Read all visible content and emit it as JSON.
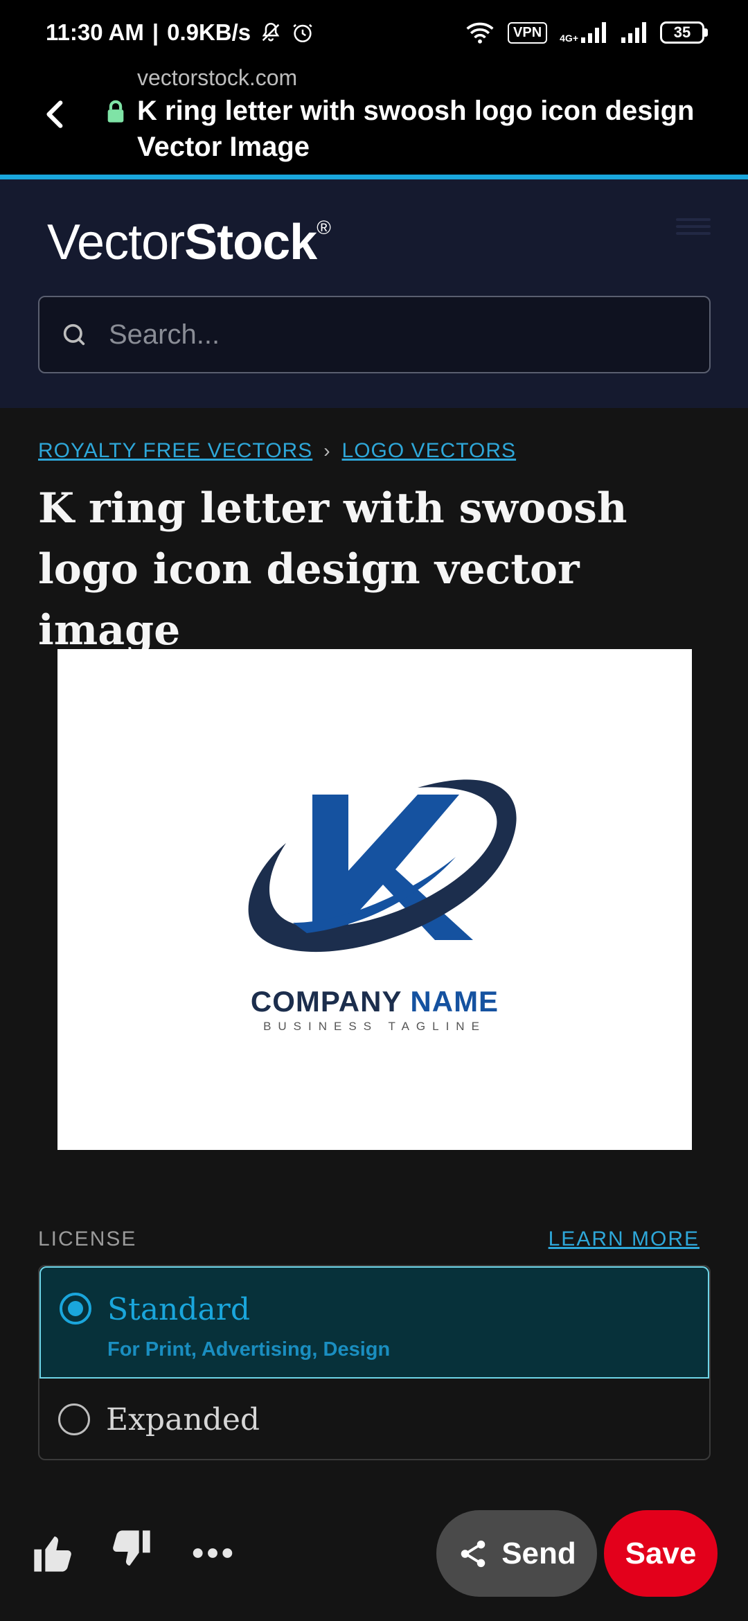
{
  "status_bar": {
    "time": "11:30 AM",
    "speed": "0.9KB/s",
    "vpn": "VPN",
    "network": "4G+",
    "battery": "35"
  },
  "browser": {
    "domain": "vectorstock.com",
    "title": "K ring letter with swoosh logo icon design Vector Image"
  },
  "site": {
    "logo_light": "Vector",
    "logo_bold": "Stock",
    "logo_mark": "®",
    "search_placeholder": "Search..."
  },
  "breadcrumb": {
    "items": [
      "ROYALTY FREE VECTORS",
      "LOGO VECTORS"
    ],
    "separator": "›"
  },
  "page": {
    "title": "K ring letter with swoosh logo icon design vector image"
  },
  "preview": {
    "company_word1": "COMPANY",
    "company_word2": "NAME",
    "tagline": "BUSINESS TAGLINE"
  },
  "license": {
    "label": "LICENSE",
    "learn_more": "LEARN MORE",
    "options": [
      {
        "title": "Standard",
        "subtitle": "For Print, Advertising, Design",
        "selected": true
      },
      {
        "title": "Expanded",
        "selected": false
      }
    ]
  },
  "bottom_bar": {
    "send": "Send",
    "save": "Save"
  },
  "colors": {
    "accent": "#1aa6dc",
    "save": "#e3001b",
    "logo_blue": "#1552a0",
    "logo_navy": "#1c2e4d"
  }
}
